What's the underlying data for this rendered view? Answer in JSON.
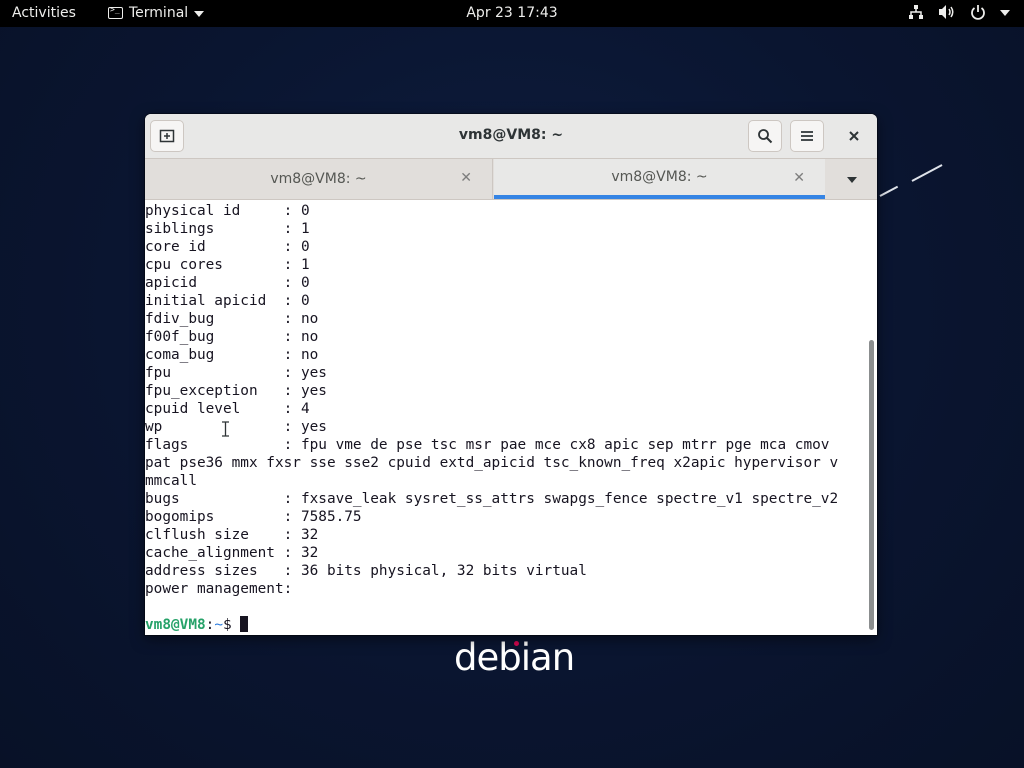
{
  "topbar": {
    "activities": "Activities",
    "app_menu_label": "Terminal",
    "clock": "Apr 23  17:43",
    "status_icons": [
      "network-icon",
      "volume-icon",
      "power-icon"
    ]
  },
  "window": {
    "title": "vm8@VM8: ~",
    "buttons": {
      "new_tab": "new-tab-icon",
      "search": "search-icon",
      "menu": "hamburger-menu-icon",
      "close": "close-icon"
    }
  },
  "tabs": [
    {
      "label": "vm8@VM8: ~",
      "active": false
    },
    {
      "label": "vm8@VM8: ~",
      "active": true
    }
  ],
  "terminal": {
    "lines": [
      "physical id     : 0",
      "siblings        : 1",
      "core id         : 0",
      "cpu cores       : 1",
      "apicid          : 0",
      "initial apicid  : 0",
      "fdiv_bug        : no",
      "f00f_bug        : no",
      "coma_bug        : no",
      "fpu             : yes",
      "fpu_exception   : yes",
      "cpuid level     : 4",
      "wp              : yes",
      "flags           : fpu vme de pse tsc msr pae mce cx8 apic sep mtrr pge mca cmov",
      "pat pse36 mmx fxsr sse sse2 cpuid extd_apicid tsc_known_freq x2apic hypervisor v",
      "mmcall",
      "bugs            : fxsave_leak sysret_ss_attrs swapgs_fence spectre_v1 spectre_v2",
      "bogomips        : 7585.75",
      "clflush size    : 32",
      "cache_alignment : 32",
      "address sizes   : 36 bits physical, 32 bits virtual",
      "power management:",
      ""
    ],
    "prompt": {
      "user_host": "vm8@VM8",
      "separator": ":",
      "path": "~",
      "symbol": "$ "
    }
  },
  "wallpaper": {
    "logo_text": "debian"
  },
  "colors": {
    "topbar_bg": "#000000",
    "desktop_bg": "#0a1530",
    "accent": "#3584e4",
    "prompt_user": "#26a269",
    "prompt_path": "#2a7bde",
    "logo_dot": "#d70751"
  }
}
